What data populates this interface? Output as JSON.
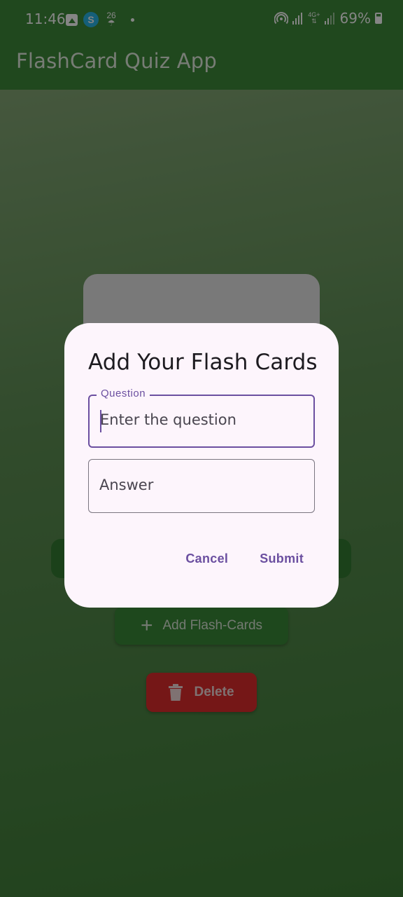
{
  "status_bar": {
    "time": "11:46",
    "weather_temp": "26",
    "network": "4G+",
    "battery_percent": "69%",
    "battery_level": 0.69
  },
  "app_bar": {
    "title": "FlashCard Quiz App"
  },
  "home": {
    "add_button_label": "Add Flash-Cards",
    "delete_button_label": "Delete"
  },
  "dialog": {
    "title": "Add Your Flash Cards",
    "question": {
      "label": "Question",
      "placeholder": "Enter the question",
      "value": ""
    },
    "answer": {
      "placeholder": "Answer",
      "value": ""
    },
    "cancel_label": "Cancel",
    "submit_label": "Submit"
  },
  "colors": {
    "primary_green": "#3f8a3a",
    "delete_red": "#e02c2c",
    "dialog_bg": "#fdf5fc",
    "accent_purple": "#6b4fa0"
  },
  "icons": {
    "gallery": "gallery-icon",
    "app_notification": "app-badge-icon",
    "weather": "temperature-icon",
    "hotspot": "hotspot-icon",
    "signal": "signal-icon",
    "battery": "battery-icon",
    "add": "plus-icon",
    "delete": "trash-icon"
  }
}
